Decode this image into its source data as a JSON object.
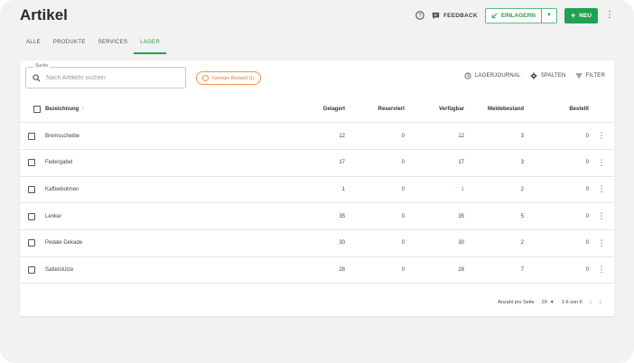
{
  "header": {
    "title": "Artikel",
    "feedback_label": "FEEDBACK",
    "einlagern_label": "EINLAGERN",
    "neu_label": "NEU"
  },
  "tabs": [
    {
      "label": "ALLE"
    },
    {
      "label": "PRODUKTE"
    },
    {
      "label": "SERVICES"
    },
    {
      "label": "LAGER",
      "active": true
    }
  ],
  "search": {
    "legend": "Suche",
    "placeholder": "Nach Artikeln suchen"
  },
  "chip": {
    "label": "Geringer Bestand (1)"
  },
  "toolbar": {
    "lagerjournal": "LAGERJOURNAL",
    "spalten": "SPALTEN",
    "filter": "FILTER"
  },
  "table": {
    "columns": {
      "bezeichnung": "Bezeichnung",
      "gelagert": "Gelagert",
      "reserviert": "Reserviert",
      "verfuegbar": "Verfügbar",
      "meldebestand": "Meldebestand",
      "bestellt": "Bestellt"
    },
    "rows": [
      {
        "name": "Bremsscheibe",
        "gelagert": "12",
        "reserviert": "0",
        "verfuegbar": "12",
        "meldebestand": "3",
        "bestellt": "0"
      },
      {
        "name": "Federgabel",
        "gelagert": "17",
        "reserviert": "0",
        "verfuegbar": "17",
        "meldebestand": "3",
        "bestellt": "0"
      },
      {
        "name": "Kaffeebohnen",
        "gelagert": "1",
        "reserviert": "0",
        "verfuegbar": "1",
        "meldebestand": "2",
        "bestellt": "0"
      },
      {
        "name": "Lenker",
        "gelagert": "35",
        "reserviert": "0",
        "verfuegbar": "35",
        "meldebestand": "5",
        "bestellt": "0"
      },
      {
        "name": "Pedale Dekade",
        "gelagert": "30",
        "reserviert": "0",
        "verfuegbar": "30",
        "meldebestand": "2",
        "bestellt": "0"
      },
      {
        "name": "Sattelstütze",
        "gelagert": "28",
        "reserviert": "0",
        "verfuegbar": "28",
        "meldebestand": "7",
        "bestellt": "0"
      }
    ]
  },
  "pager": {
    "per_page_label": "Anzahl pro Seite",
    "per_page_value": "20",
    "range": "1-6 von 6"
  },
  "colors": {
    "accent": "#1fa34f",
    "warning": "#e07b3a"
  }
}
